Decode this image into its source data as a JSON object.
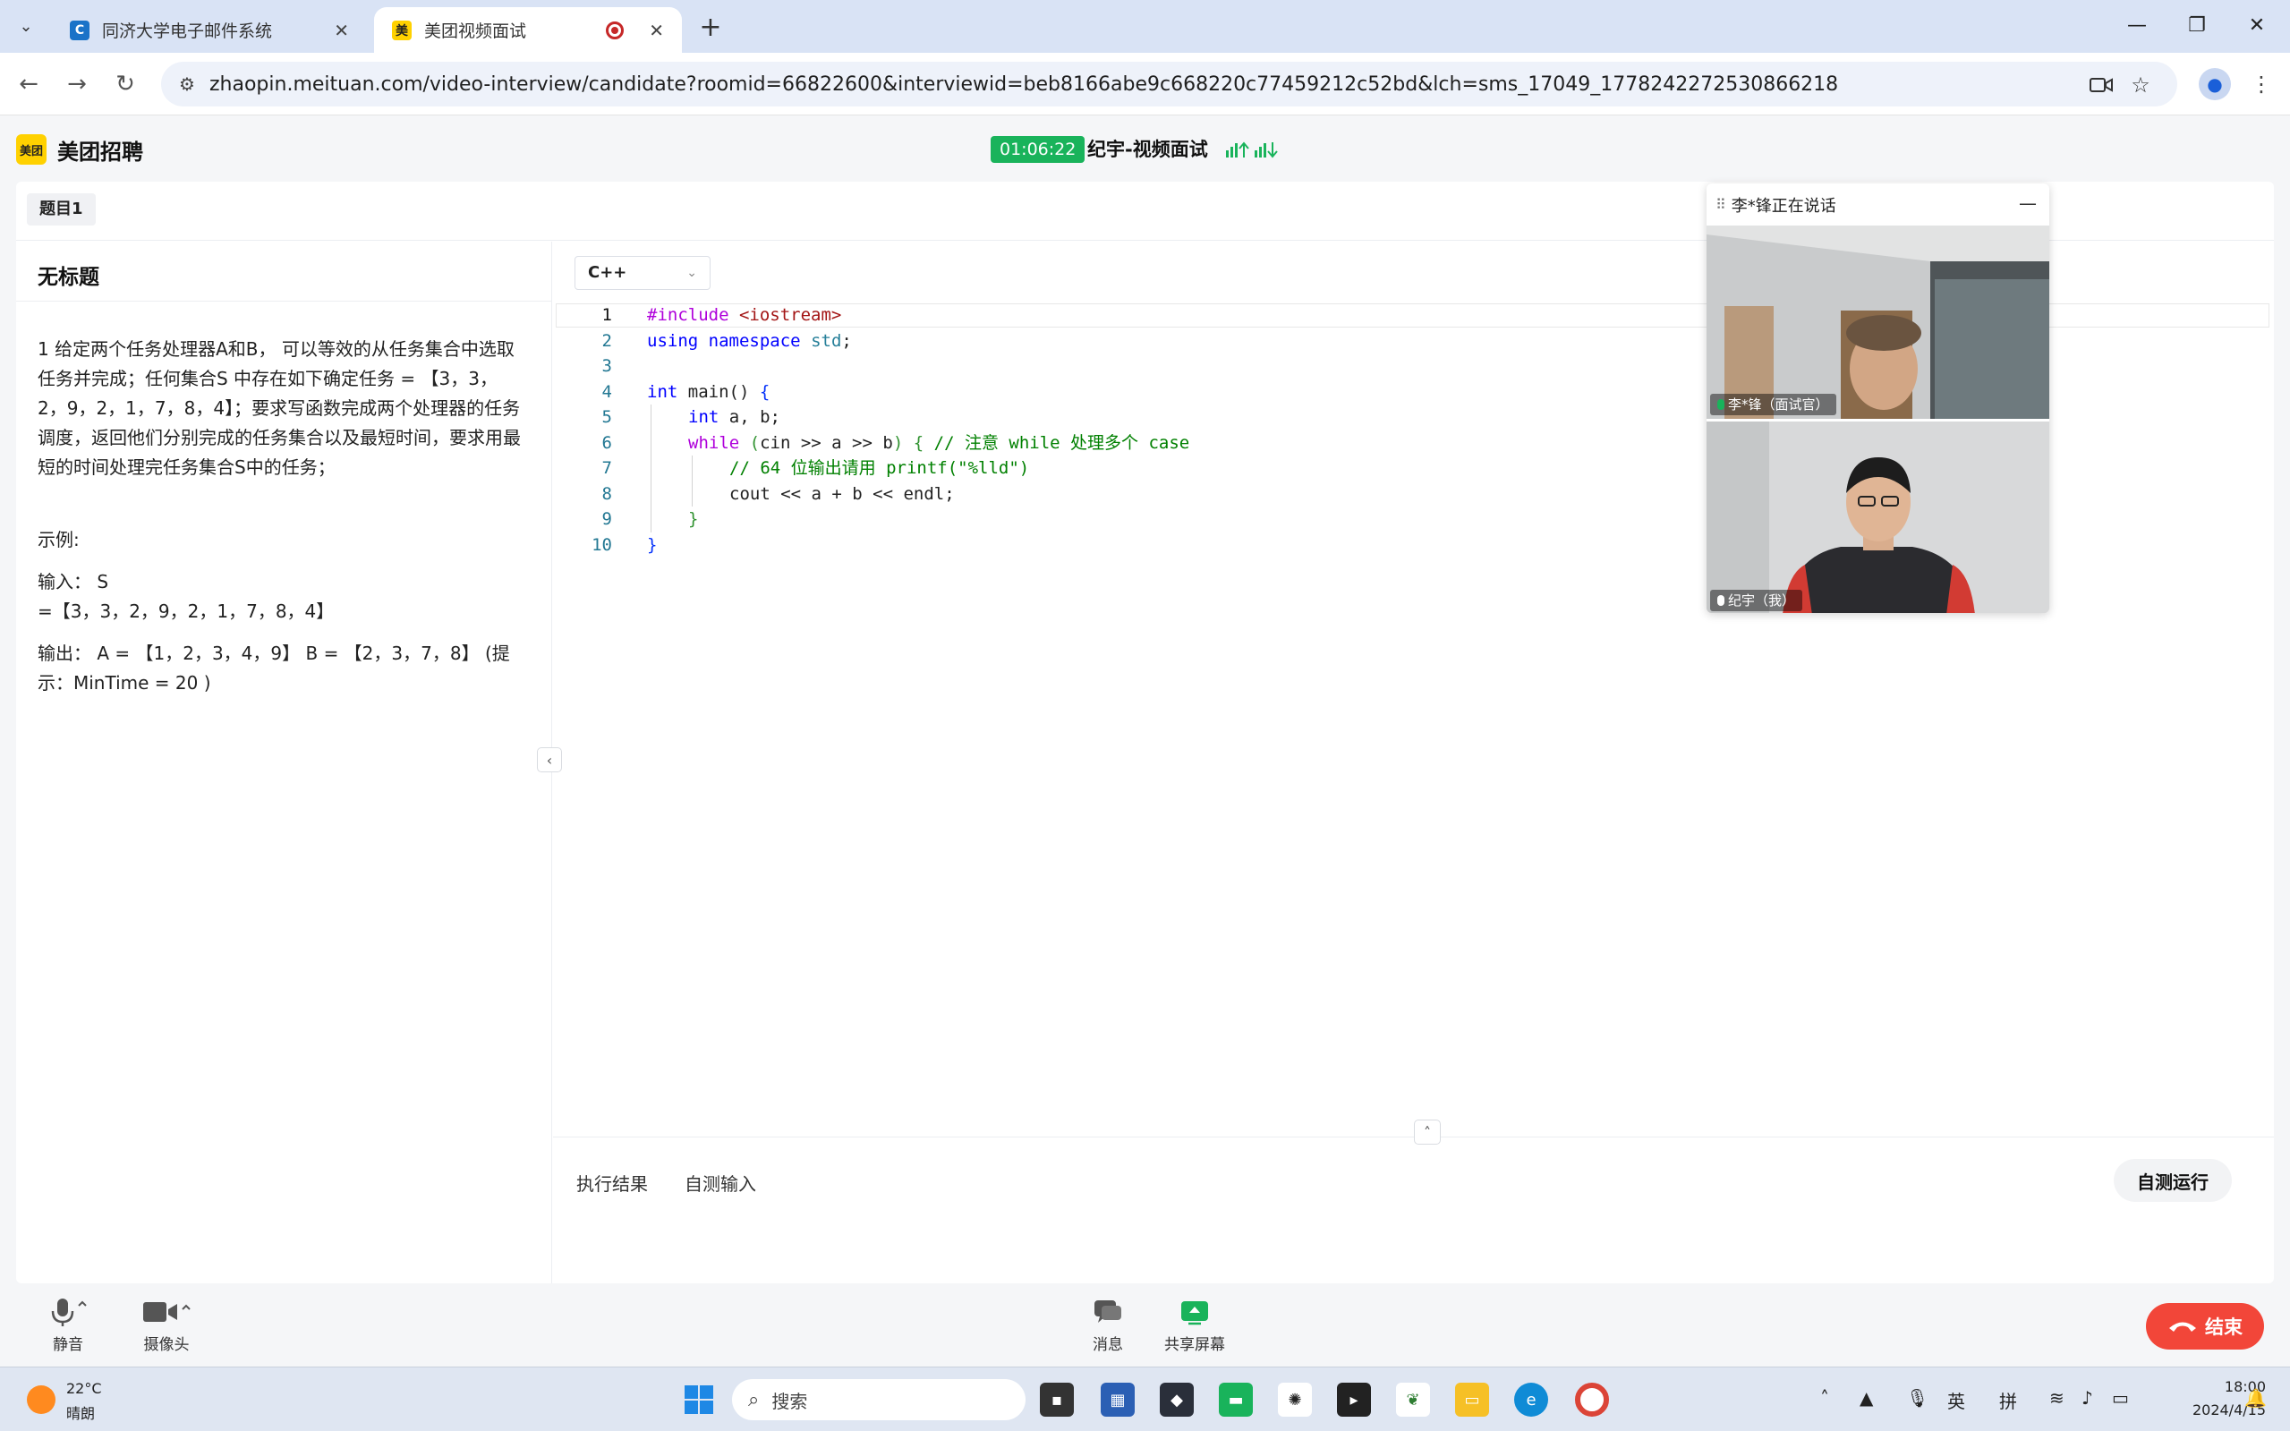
{
  "browser": {
    "tabs": [
      {
        "title": "同济大学电子邮件系统",
        "favicon": "C",
        "active": false
      },
      {
        "title": "美团视频面试",
        "favicon": "美",
        "active": true
      }
    ],
    "url": "zhaopin.meituan.com/video-interview/candidate?roomid=66822600&interviewid=beb8166abe9c668220c77459212c52bd&lch=sms_17049_1778242272530866218"
  },
  "header": {
    "logo_badge": "美团",
    "logo_text": "美团招聘",
    "timer": "01:06:22",
    "session_title": "纪宇-视频面试",
    "signal_color": "#19b35b"
  },
  "question_tabs": [
    "题目1"
  ],
  "problem": {
    "title": "无标题",
    "description": "1 给定两个任务处理器A和B， 可以等效的从任务集合中选取任务并完成；任何集合S 中存在如下确定任务 = 【3，3，2，9，2，1，7，8，4】；要求写函数完成两个处理器的任务调度，返回他们分别完成的任务集合以及最短时间，要求用最短的时间处理完任务集合S中的任务；",
    "example_label": "示例:",
    "input_line1": "输入：  S",
    "input_line2": "=【3，3，2，9，2，1，7，8，4】",
    "output_text": "输出：  A = 【1，2，3，4，9】 B = 【2，3，7，8】 (提示：MinTime = 20 )"
  },
  "editor": {
    "language": "C++",
    "lines": [
      {
        "n": "1",
        "parts": [
          [
            "kw",
            "#include "
          ],
          [
            "str",
            "<iostream>"
          ]
        ]
      },
      {
        "n": "2",
        "parts": [
          [
            "k",
            "using"
          ],
          [
            "",
            " "
          ],
          [
            "k",
            "namespace"
          ],
          [
            "",
            " "
          ],
          [
            "ty",
            "std"
          ],
          [
            "",
            ";"
          ]
        ]
      },
      {
        "n": "3",
        "parts": []
      },
      {
        "n": "4",
        "parts": [
          [
            "k",
            "int"
          ],
          [
            "",
            " main() "
          ],
          [
            "br1",
            "{"
          ]
        ]
      },
      {
        "n": "5",
        "indent": 1,
        "parts": [
          [
            "k",
            "int"
          ],
          [
            "",
            " a, b;"
          ]
        ]
      },
      {
        "n": "6",
        "indent": 1,
        "parts": [
          [
            "kw",
            "while"
          ],
          [
            "",
            " "
          ],
          [
            "br2",
            "("
          ],
          [
            "",
            "cin >> a >> b"
          ],
          [
            "br2",
            ")"
          ],
          [
            "",
            " "
          ],
          [
            "br2",
            "{"
          ],
          [
            "",
            " "
          ],
          [
            "cm",
            "// 注意 while 处理多个 case"
          ]
        ]
      },
      {
        "n": "7",
        "indent": 2,
        "parts": [
          [
            "cm",
            "// 64 位输出请用 printf(\"%lld\")"
          ]
        ]
      },
      {
        "n": "8",
        "indent": 2,
        "parts": [
          [
            "",
            "cout << a + b << endl;"
          ]
        ]
      },
      {
        "n": "9",
        "indent": 1,
        "parts": [
          [
            "br2",
            "}"
          ]
        ]
      },
      {
        "n": "10",
        "parts": [
          [
            "br1",
            "}"
          ]
        ]
      }
    ]
  },
  "bottom_tabs": {
    "result": "执行结果",
    "custom_input": "自测输入"
  },
  "run_button": "自测运行",
  "video": {
    "speaking": "李*锋正在说话",
    "feeds": [
      {
        "label": "李*锋（面试官）"
      },
      {
        "label": "纪宇（我）"
      }
    ]
  },
  "controls": {
    "mute": "静音",
    "camera": "摄像头",
    "messages": "消息",
    "share": "共享屏幕",
    "end": "结束",
    "end_color": "#f24639"
  },
  "taskbar": {
    "temp": "22°C",
    "weather": "晴朗",
    "search_placeholder": "搜索",
    "ime_lang": "英",
    "ime_mode": "拼",
    "time": "18:00",
    "date": "2024/4/15"
  }
}
